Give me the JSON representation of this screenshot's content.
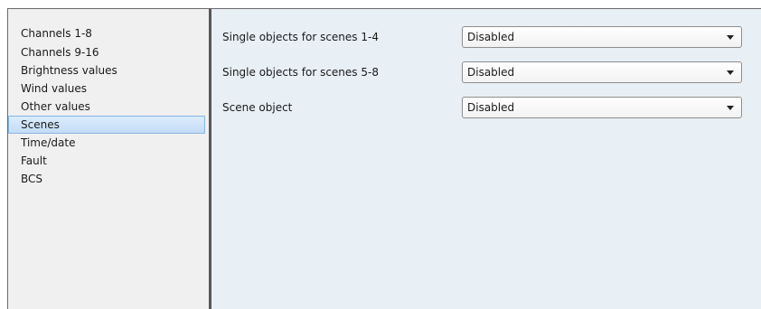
{
  "sidebar": {
    "items": [
      {
        "label": "Channels 1-8",
        "selected": false
      },
      {
        "label": "Channels 9-16",
        "selected": false
      },
      {
        "label": "Brightness values",
        "selected": false
      },
      {
        "label": "Wind values",
        "selected": false
      },
      {
        "label": "Other values",
        "selected": false
      },
      {
        "label": "Scenes",
        "selected": true
      },
      {
        "label": "Time/date",
        "selected": false
      },
      {
        "label": "Fault",
        "selected": false
      },
      {
        "label": "BCS",
        "selected": false
      }
    ]
  },
  "content": {
    "rows": [
      {
        "label": "Single objects for scenes 1-4",
        "value": "Disabled"
      },
      {
        "label": "Single objects for scenes 5-8",
        "value": "Disabled"
      },
      {
        "label": "Scene object",
        "value": "Disabled"
      }
    ]
  },
  "colors": {
    "sidebar_bg": "#f0f0f0",
    "content_bg": "#e8eff5",
    "selection_border": "#86b5e6",
    "selection_fill": "#c3dcf6",
    "splitter": "#585858"
  },
  "icons": {
    "dropdown": "chevron-down-icon"
  }
}
